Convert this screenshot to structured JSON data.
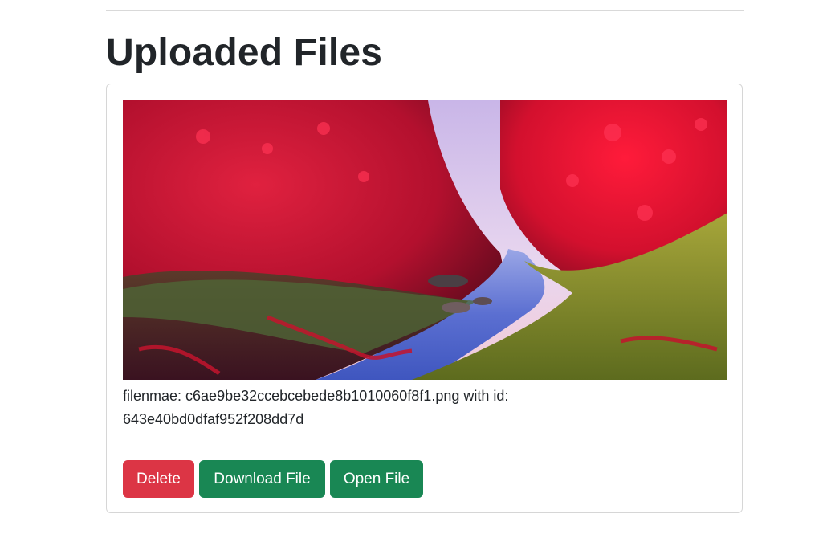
{
  "page": {
    "title": "Uploaded Files"
  },
  "file_card": {
    "filename_line": "filenmae: c6ae9be32ccebcebede8b1010060f8f1.png with id:",
    "id_line": "643e40bd0dfaf952f208dd7d",
    "image_alt": "uploaded image preview"
  },
  "actions": {
    "delete_label": "Delete",
    "download_label": "Download File",
    "open_label": "Open File"
  },
  "colors": {
    "danger": "#dc3545",
    "success": "#198754",
    "text": "#212529"
  }
}
